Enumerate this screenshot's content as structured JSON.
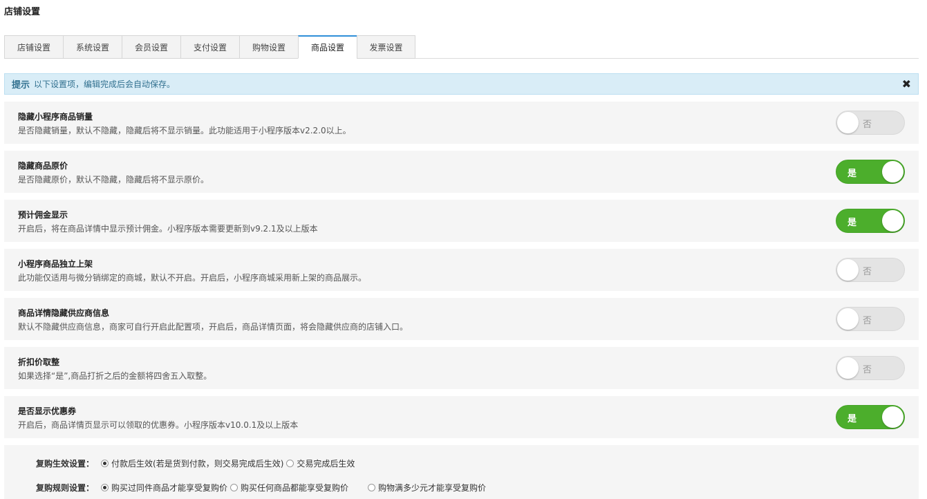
{
  "page": {
    "title": "店铺设置"
  },
  "tabs": [
    {
      "label": "店铺设置",
      "active": false
    },
    {
      "label": "系统设置",
      "active": false
    },
    {
      "label": "会员设置",
      "active": false
    },
    {
      "label": "支付设置",
      "active": false
    },
    {
      "label": "购物设置",
      "active": false
    },
    {
      "label": "商品设置",
      "active": true
    },
    {
      "label": "发票设置",
      "active": false
    }
  ],
  "alert": {
    "strong": "提示",
    "text": "以下设置项，编辑完成后会自动保存。",
    "close": "✖"
  },
  "settings": [
    {
      "title": "隐藏小程序商品销量",
      "desc": "是否隐藏销量，默认不隐藏，隐藏后将不显示销量。此功能适用于小程序版本v2.2.0以上。",
      "on": false,
      "label": "否"
    },
    {
      "title": "隐藏商品原价",
      "desc": "是否隐藏原价，默认不隐藏，隐藏后将不显示原价。",
      "on": true,
      "label": "是"
    },
    {
      "title": "预计佣金显示",
      "desc": "开启后，将在商品详情中显示预计佣金。小程序版本需要更新到v9.2.1及以上版本",
      "on": true,
      "label": "是"
    },
    {
      "title": "小程序商品独立上架",
      "desc": "此功能仅适用与微分销绑定的商城，默认不开启。开启后，小程序商城采用新上架的商品展示。",
      "on": false,
      "label": "否"
    },
    {
      "title": "商品详情隐藏供应商信息",
      "desc": "默认不隐藏供应商信息，商家可自行开启此配置项，开启后，商品详情页面，将会隐藏供应商的店铺入口。",
      "on": false,
      "label": "否"
    },
    {
      "title": "折扣价取整",
      "desc": "如果选择“是”,商品打折之后的金额将四舍五入取整。",
      "on": false,
      "label": "否"
    },
    {
      "title": "是否显示优惠券",
      "desc": "开启后，商品详情页显示可以领取的优惠券。小程序版本v10.0.1及以上版本",
      "on": true,
      "label": "是"
    }
  ],
  "repurchase": {
    "effect": {
      "label": "复购生效设置：",
      "options": [
        {
          "label": "付款后生效(若是货到付款，则交易完成后生效)",
          "checked": true
        },
        {
          "label": "交易完成后生效",
          "checked": false
        }
      ]
    },
    "rule": {
      "label": "复购规则设置：",
      "options": [
        {
          "label": "购买过同件商品才能享受复购价",
          "checked": true
        },
        {
          "label": "购买任何商品都能享受复购价",
          "checked": false
        },
        {
          "label": "购物满多少元才能享受复购价",
          "checked": false
        }
      ]
    }
  }
}
